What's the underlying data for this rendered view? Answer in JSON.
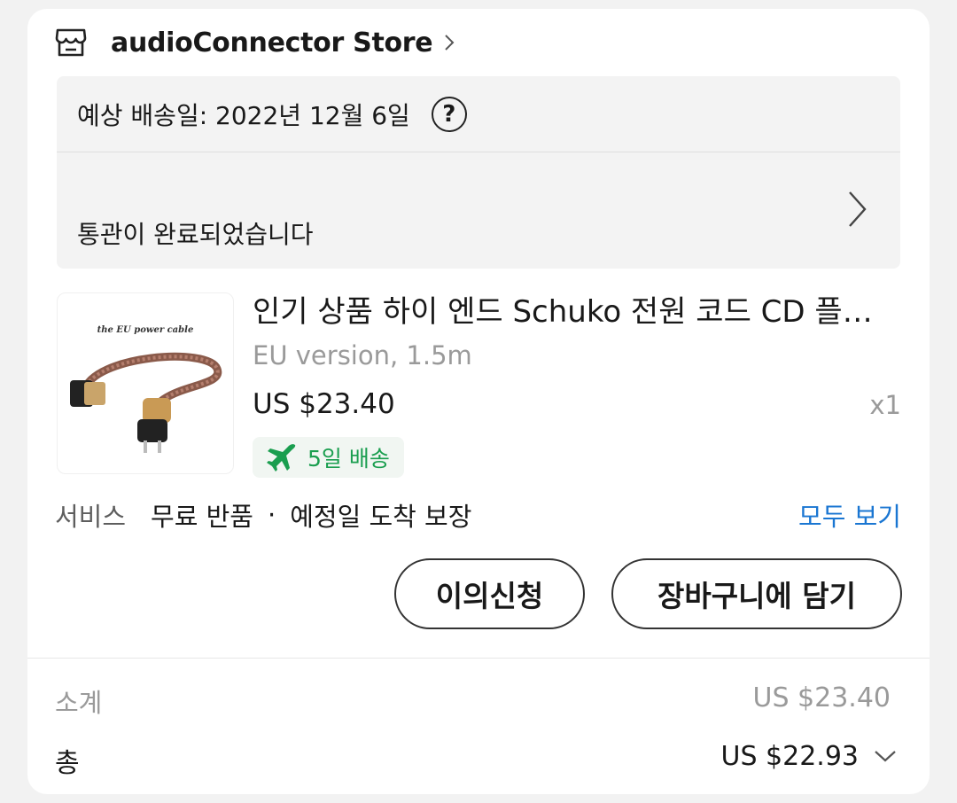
{
  "store": {
    "name": "audioConnector Store",
    "icon": "storefront-icon"
  },
  "delivery": {
    "estimated_label": "예상 배송일: 2022년 12월 6일",
    "customs_status": "통관이 완료되었습니다"
  },
  "product": {
    "image_caption": "the EU power cable",
    "title": "인기 상품 하이 엔드 Schuko 전원 코드 CD 플레이어 파워 앰프 EU 전원 케이블",
    "variant": "EU version, 1.5m",
    "price": "US $23.40",
    "quantity": "x1",
    "shipping_badge": "5일 배송",
    "shipping_color": "#1a9e4f"
  },
  "services": {
    "label": "서비스",
    "item1": "무료 반품",
    "separator": "·",
    "item2": "예정일 도착 보장",
    "view_all": "모두 보기",
    "link_color": "#1a76d2"
  },
  "actions": {
    "dispute": "이의신청",
    "add_to_cart": "장바구니에 담기"
  },
  "summary": {
    "subtotal_label": "소계",
    "subtotal_value": "US $23.40",
    "total_label": "총",
    "total_value": "US $22.93"
  }
}
